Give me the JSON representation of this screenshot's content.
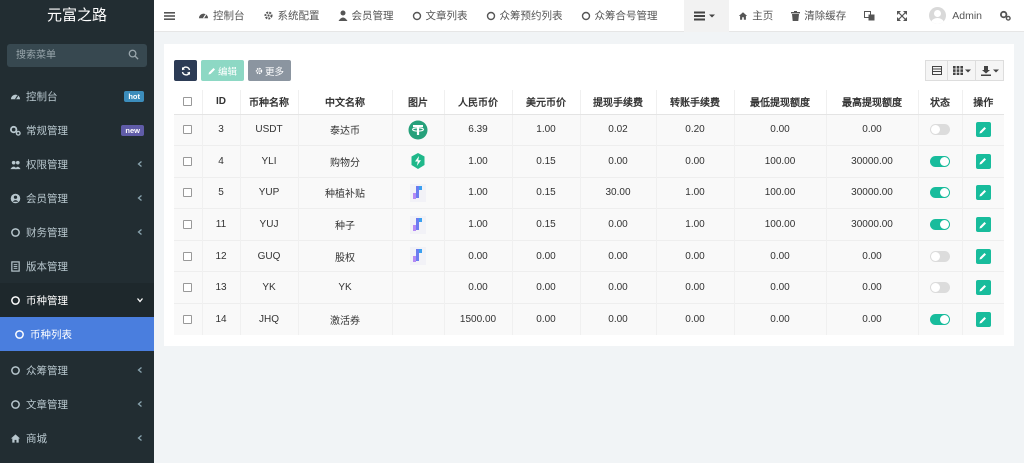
{
  "sidebar": {
    "logo": "元富之路",
    "search_placeholder": "搜索菜单",
    "items": [
      {
        "label": "控制台",
        "icon": "dashboard-icon",
        "badge": "hot"
      },
      {
        "label": "常规管理",
        "icon": "cogs-icon",
        "badge": "new"
      },
      {
        "label": "权限管理",
        "icon": "users-icon"
      },
      {
        "label": "会员管理",
        "icon": "user-circle-icon"
      },
      {
        "label": "财务管理",
        "icon": "circle-icon"
      },
      {
        "label": "版本管理",
        "icon": "file-icon"
      },
      {
        "label": "币种管理",
        "icon": "circle-icon"
      },
      {
        "label": "币种列表",
        "icon": "circle-icon"
      },
      {
        "label": "众筹管理",
        "icon": "circle-icon"
      },
      {
        "label": "文章管理",
        "icon": "circle-icon"
      },
      {
        "label": "商城",
        "icon": "home-icon"
      }
    ]
  },
  "topnav": {
    "tabs": [
      {
        "label": "控制台",
        "icon": "dashboard-icon"
      },
      {
        "label": "系统配置",
        "icon": "gear-icon"
      },
      {
        "label": "会员管理",
        "icon": "user-icon"
      },
      {
        "label": "文章列表",
        "icon": "circle-icon"
      },
      {
        "label": "众筹预约列表",
        "icon": "circle-icon"
      },
      {
        "label": "众筹合号管理",
        "icon": "circle-icon"
      }
    ],
    "home": "主页",
    "clear_cache": "清除缓存",
    "user": "Admin"
  },
  "toolbar": {
    "edit": "编辑",
    "more": "更多"
  },
  "table": {
    "headers": [
      "ID",
      "币种名称",
      "中文名称",
      "图片",
      "人民币价",
      "美元币价",
      "提现手续费",
      "转账手续费",
      "最低提现额度",
      "最高提现额度",
      "状态",
      "操作"
    ],
    "rows": [
      {
        "id": "3",
        "code": "USDT",
        "name": "泰达币",
        "img": "tether",
        "cny": "6.39",
        "usd": "1.00",
        "wfee": "0.02",
        "tfee": "0.20",
        "min": "0.00",
        "max": "0.00",
        "on": false
      },
      {
        "id": "4",
        "code": "YLI",
        "name": "购物分",
        "img": "bolt",
        "cny": "1.00",
        "usd": "0.15",
        "wfee": "0.00",
        "tfee": "0.00",
        "min": "100.00",
        "max": "30000.00",
        "on": true
      },
      {
        "id": "5",
        "code": "YUP",
        "name": "种植补贴",
        "img": "fc",
        "cny": "1.00",
        "usd": "0.15",
        "wfee": "30.00",
        "tfee": "1.00",
        "min": "100.00",
        "max": "30000.00",
        "on": true
      },
      {
        "id": "11",
        "code": "YUJ",
        "name": "种子",
        "img": "fc",
        "cny": "1.00",
        "usd": "0.15",
        "wfee": "0.00",
        "tfee": "1.00",
        "min": "100.00",
        "max": "30000.00",
        "on": true
      },
      {
        "id": "12",
        "code": "GUQ",
        "name": "股权",
        "img": "fc",
        "cny": "0.00",
        "usd": "0.00",
        "wfee": "0.00",
        "tfee": "0.00",
        "min": "0.00",
        "max": "0.00",
        "on": false
      },
      {
        "id": "13",
        "code": "YK",
        "name": "YK",
        "img": "",
        "cny": "0.00",
        "usd": "0.00",
        "wfee": "0.00",
        "tfee": "0.00",
        "min": "0.00",
        "max": "0.00",
        "on": false
      },
      {
        "id": "14",
        "code": "JHQ",
        "name": "激活券",
        "img": "",
        "cny": "1500.00",
        "usd": "0.00",
        "wfee": "0.00",
        "tfee": "0.00",
        "min": "0.00",
        "max": "0.00",
        "on": true
      }
    ]
  },
  "colors": {
    "sidebar_bg": "#222d32",
    "active_item": "#4a7ede",
    "accent_green": "#18bc9c"
  }
}
